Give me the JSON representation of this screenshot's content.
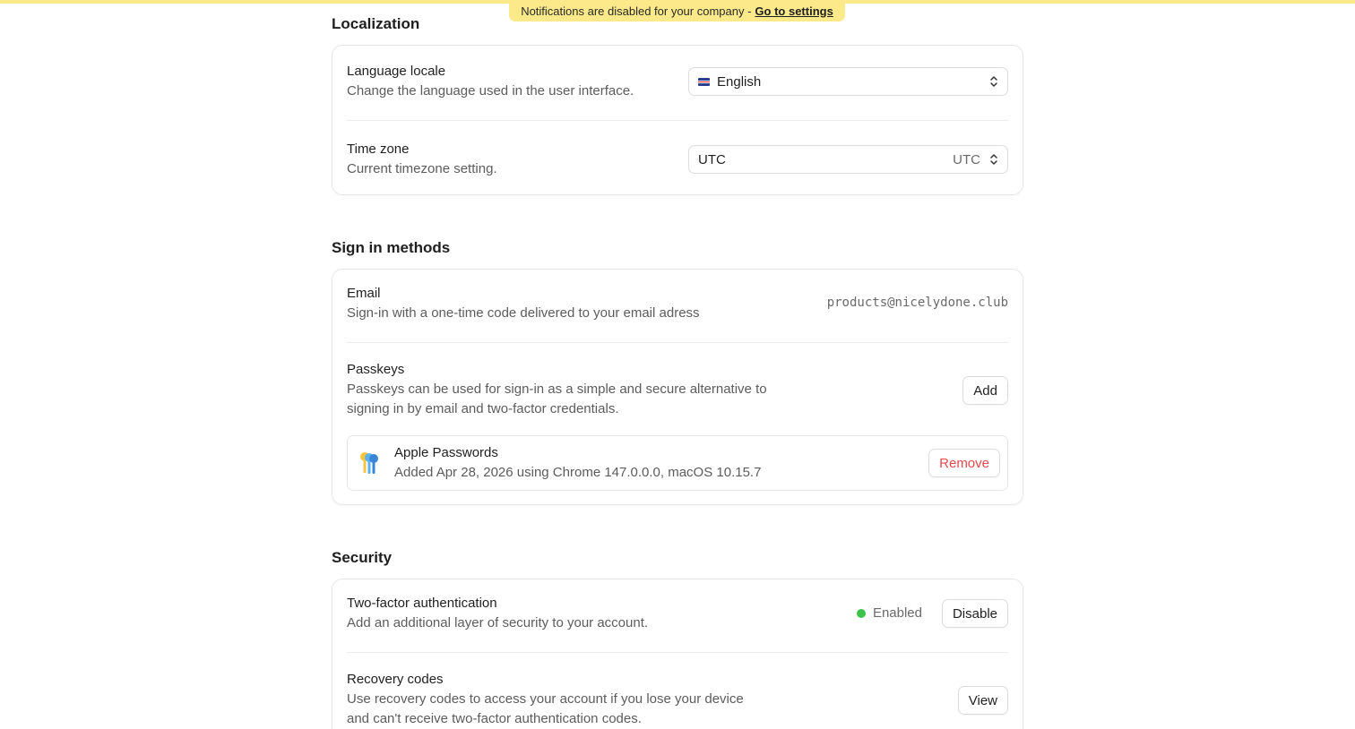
{
  "notice": {
    "text": "Notifications are disabled for your company -",
    "link": "Go to settings"
  },
  "localization": {
    "title": "Localization",
    "language": {
      "title": "Language locale",
      "desc": "Change the language used in the user interface.",
      "value": "English",
      "flag_icon": "uk-flag-icon"
    },
    "timezone": {
      "title": "Time zone",
      "desc": "Current timezone setting.",
      "value": "UTC",
      "suffix": "UTC"
    }
  },
  "signin": {
    "title": "Sign in methods",
    "email": {
      "title": "Email",
      "desc": "Sign-in with a one-time code delivered to your email adress",
      "value": "products@nicelydone.club"
    },
    "passkeys": {
      "title": "Passkeys",
      "desc_line1": "Passkeys can be used for sign-in as a simple and secure alternative to",
      "desc_line2": "signing in by email and two-factor credentials.",
      "add_label": "Add",
      "item": {
        "icon": "keys-icon",
        "name": "Apple Passwords",
        "detail": "Added Apr 28, 2026 using Chrome 147.0.0.0, macOS 10.15.7",
        "remove_label": "Remove"
      }
    }
  },
  "security": {
    "title": "Security",
    "twofa": {
      "title": "Two-factor authentication",
      "desc": "Add an additional layer of security to your account.",
      "status": "Enabled",
      "status_color": "#3cc44a",
      "disable_label": "Disable"
    },
    "recovery": {
      "title": "Recovery codes",
      "desc_line1": "Use recovery codes to access your account if you lose your device",
      "desc_line2": "and can't receive two-factor authentication codes.",
      "view_label": "View"
    }
  },
  "colors": {
    "banner": "#fbe98a",
    "danger": "#e5484d",
    "success": "#3cc44a"
  }
}
